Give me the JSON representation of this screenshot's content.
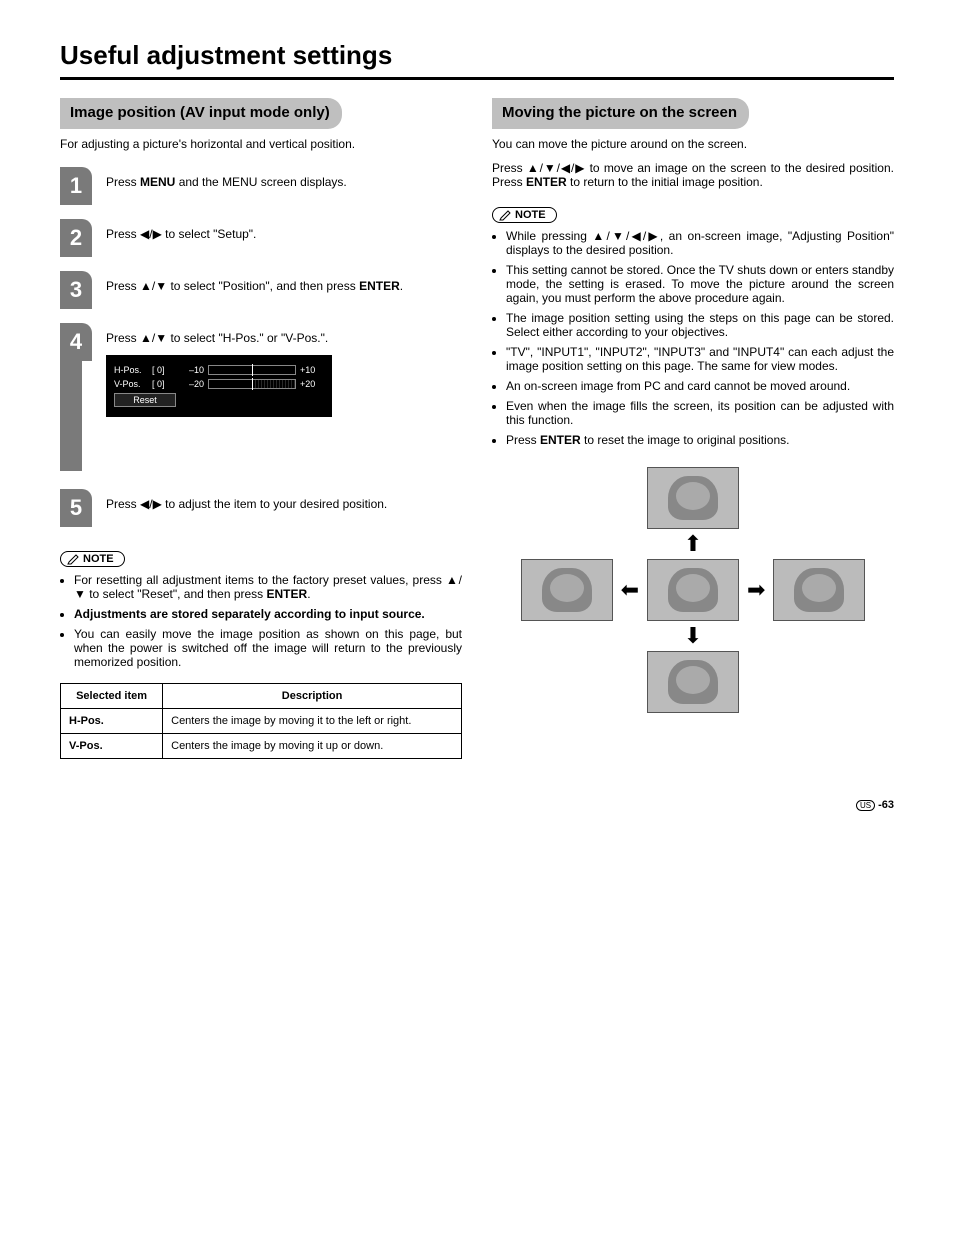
{
  "title": "Useful adjustment settings",
  "left": {
    "heading": "Image position (AV input mode only)",
    "intro": "For adjusting a picture's horizontal and vertical position.",
    "steps": {
      "s1a": "Press ",
      "s1b": "MENU",
      "s1c": " and the MENU screen displays.",
      "s2a": "Press ",
      "s2b": " to select \"Setup\".",
      "s3a": "Press ",
      "s3b": " to select \"Position\", and then press ",
      "s3c": "ENTER",
      "s3d": ".",
      "s4a": "Press ",
      "s4b": " to select \"H-Pos.\" or \"V-Pos.\".",
      "s5a": "Press ",
      "s5b": " to adjust the item to your desired position."
    },
    "osd": {
      "h_label": "H-Pos.",
      "h_val": "[   0]",
      "h_min": "–10",
      "h_max": "+10",
      "v_label": "V-Pos.",
      "v_val": "[   0]",
      "v_min": "–20",
      "v_max": "+20",
      "reset": "Reset"
    },
    "note_label": "NOTE",
    "notes": {
      "n1a": "For resetting all adjustment items to the factory preset values, press ",
      "n1b": " to select \"Reset\", and then press ",
      "n1c": "ENTER",
      "n1d": ".",
      "n2": "Adjustments are stored separately according to input source.",
      "n3": "You can easily move the image position as shown on this page, but when the power is switched off the image will return to the previously memorized position."
    },
    "table": {
      "h1": "Selected item",
      "h2": "Description",
      "r1c1": "H-Pos.",
      "r1c2": "Centers the image by moving it to the left or right.",
      "r2c1": "V-Pos.",
      "r2c2": "Centers the image by moving it up or down."
    }
  },
  "right": {
    "heading": "Moving the picture on the screen",
    "intro": "You can move the picture around on the screen.",
    "para_a": "Press ",
    "para_b": " to move an image on the screen to the desired position. Press ",
    "para_c": "ENTER",
    "para_d": " to return to the initial image position.",
    "note_label": "NOTE",
    "notes": {
      "n1a": "While pressing ",
      "n1b": ", an on-screen image, \"Adjusting Position\" displays to the desired position.",
      "n2": "This setting cannot be stored. Once the TV shuts down or enters standby mode, the setting is erased. To move the picture around the screen again, you must perform the above procedure again.",
      "n3": "The image position setting using the steps on this page can be stored. Select either according to your objectives.",
      "n4": "\"TV\", \"INPUT1\", \"INPUT2\", \"INPUT3\" and \"INPUT4\" can each adjust the image position setting on this page. The same for view modes.",
      "n5": "An on-screen image from PC and card cannot be moved around.",
      "n6": "Even when the image fills the screen, its position can be adjusted with this function.",
      "n7a": "Press ",
      "n7b": "ENTER",
      "n7c": " to reset the image to original positions."
    }
  },
  "page": {
    "us": "US",
    "num": "-63"
  }
}
